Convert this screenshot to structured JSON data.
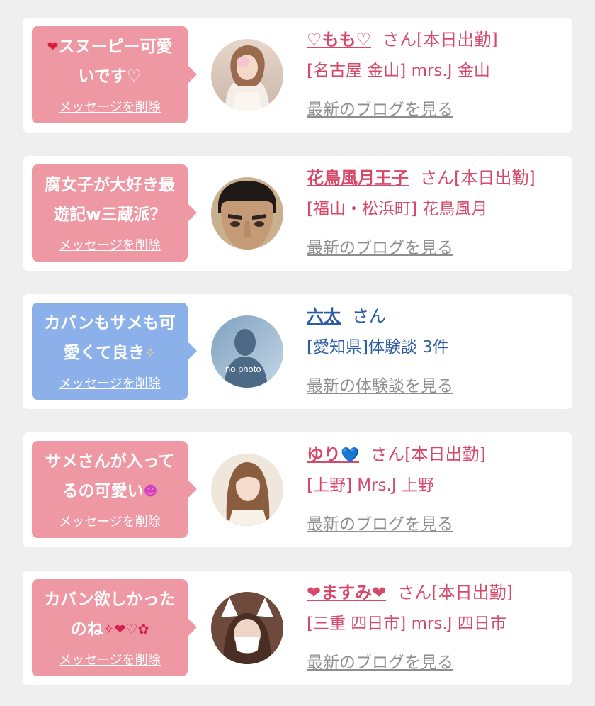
{
  "colors": {
    "pink_bubble": "#ee98a3",
    "blue_bubble": "#8bb0ea",
    "pink_text": "#d6496a",
    "blue_text": "#2d5ea5",
    "link_gray": "#8e8e8e"
  },
  "cards": [
    {
      "bubble_prefix_icon": "❤",
      "message": "スヌーピー可愛\nいです♡",
      "delete_label": "メッセージを削除",
      "avatar_icon": "woman-photo",
      "name": "♡もも♡",
      "san_label": "さん",
      "status": "[本日出勤]",
      "store": "[名古屋 金山] mrs.J 金山",
      "more_link": "最新のブログを見る"
    },
    {
      "message": "腐女子が大好き最\n遊記w三蔵派？",
      "delete_label": "メッセージを削除",
      "avatar_icon": "man-face-photo",
      "name": "花鳥風月王子",
      "san_label": "さん",
      "status": "[本日出勤]",
      "store": "[福山・松浜町] 花鳥風月",
      "more_link": "最新のブログを見る"
    },
    {
      "message": "カバンもサメも可\n愛くて良き",
      "message_suffix_icon": "✧",
      "delete_label": "メッセージを削除",
      "avatar_icon": "no-photo-silhouette",
      "avatar_text": "no photo",
      "name": "六太",
      "san_label": "さん",
      "store": "[愛知県]体験談 3件",
      "more_link": "最新の体験談を見る"
    },
    {
      "message": "サメさんが入って\nるの可愛い",
      "message_suffix_icon": "☻",
      "delete_label": "メッセージを削除",
      "avatar_icon": "woman-photo",
      "name": "ゆり",
      "name_suffix_icon": "💙",
      "san_label": "さん",
      "status": "[本日出勤]",
      "store": "[上野] Mrs.J 上野",
      "more_link": "最新のブログを見る"
    },
    {
      "message": "カバン欲しかった\nのね",
      "message_suffix_icons": "✧❤♡✿",
      "delete_label": "メッセージを削除",
      "avatar_icon": "masked-woman-photo",
      "name": "❤ますみ❤",
      "san_label": "さん",
      "status": "[本日出勤]",
      "store": "[三重 四日市] mrs.J 四日市",
      "more_link": "最新のブログを見る"
    }
  ]
}
